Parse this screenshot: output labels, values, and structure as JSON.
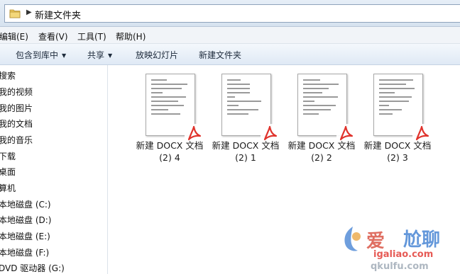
{
  "address": {
    "path": "新建文件夹"
  },
  "menu": {
    "edit": "编辑(E)",
    "view": "查看(V)",
    "tools": "工具(T)",
    "help": "帮助(H)"
  },
  "toolbar": {
    "include": "包含到库中",
    "share": "共享",
    "slideshow": "放映幻灯片",
    "new_folder": "新建文件夹"
  },
  "nav": {
    "items": [
      "搜索",
      "我的视频",
      "我的图片",
      "我的文档",
      "我的音乐",
      "下载",
      "桌面",
      "算机",
      "本地磁盘 (C:)",
      "本地磁盘 (D:)",
      "本地磁盘 (E:)",
      "本地磁盘 (F:)",
      "DVD 驱动器 (G:)"
    ]
  },
  "files": [
    {
      "line1": "新建 DOCX 文档",
      "line2": "(2) 4"
    },
    {
      "line1": "新建 DOCX 文档",
      "line2": "(2) 1"
    },
    {
      "line1": "新建 DOCX 文档",
      "line2": "(2) 2"
    },
    {
      "line1": "新建 DOCX 文档",
      "line2": "(2) 3"
    }
  ],
  "watermark": {
    "line1": "爱",
    "line2": "尬聊",
    "domain1": "igaliao.com",
    "domain2": "qkulfu.com"
  },
  "colors": {
    "pdf_red": "#e0322b",
    "watermark_blue": "#3d7ed1",
    "toolbar_bg": "#dfe9f5"
  }
}
